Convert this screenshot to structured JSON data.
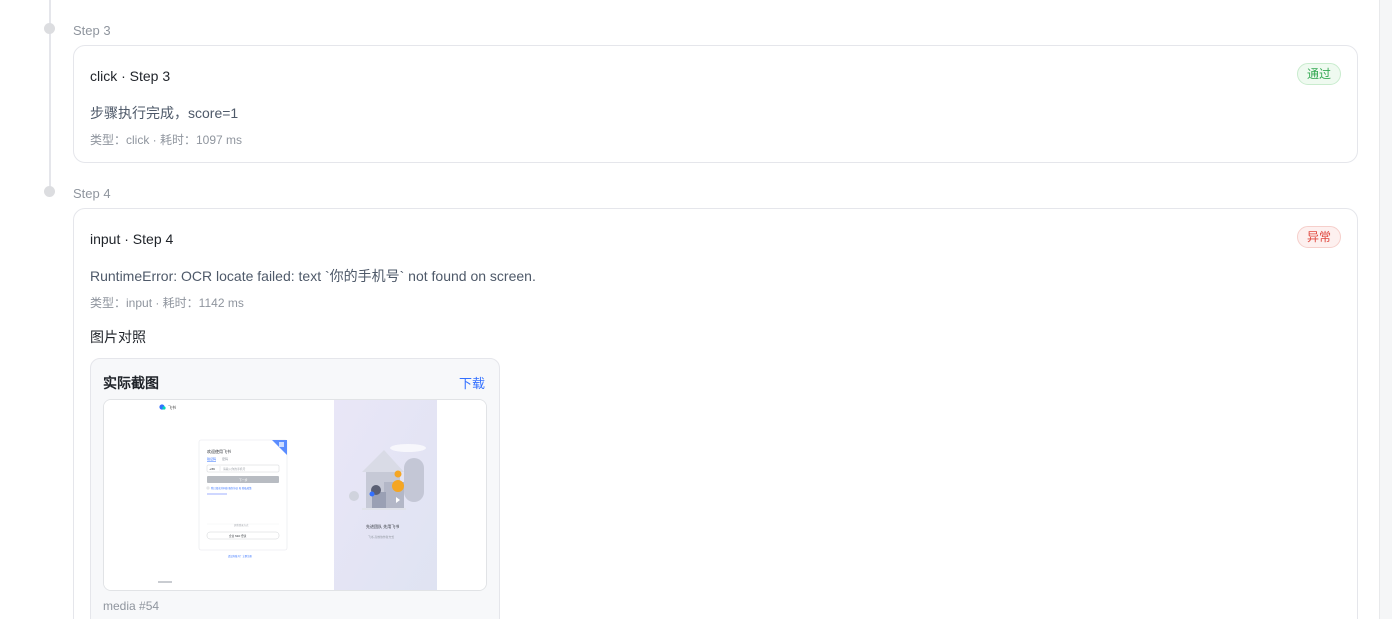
{
  "steps": [
    {
      "label": "Step 3",
      "title": "click · Step 3",
      "status": "通过",
      "message": "步骤执行完成，score=1",
      "meta": "类型：click · 耗时：1097 ms"
    },
    {
      "label": "Step 4",
      "title": "input · Step 4",
      "status": "异常",
      "message": "RuntimeError: OCR locate failed: text `你的手机号` not found on screen.",
      "meta": "类型：input · 耗时：1142 ms",
      "image_section_title": "图片对照",
      "screenshot": {
        "title": "实际截图",
        "download_label": "下载",
        "caption": "media #54",
        "inner": {
          "brand": "飞书",
          "login_heading": "欢迎使用飞书",
          "tab_phone": "验证码",
          "tab_other": "密码",
          "country_code": "+86",
          "phone_placeholder": "请输入你的手机号",
          "next_button": "下一步",
          "agreement": "我已阅读并同意 服务协议 和 隐私政策",
          "alt_login": "其他登录方式",
          "sso_button": "企业 SSO 登录",
          "footer_link": "还没有账号？立即注册",
          "promo_title": "先进团队 先用飞书",
          "promo_sub": "飞书·高效协作新方式"
        }
      }
    }
  ],
  "colors": {
    "pass_text": "#34a853",
    "error_text": "#e0483f",
    "link": "#3370ff"
  }
}
